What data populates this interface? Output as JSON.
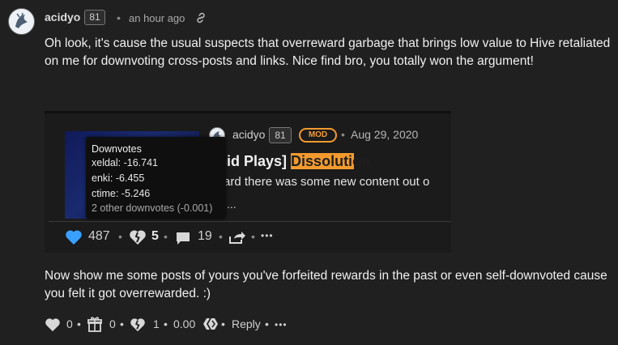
{
  "comment": {
    "username": "acidyo",
    "reputation": "81",
    "time": "an hour ago",
    "paragraph1": "Oh look, it's cause the usual suspects that overreward garbage that brings low value to Hive retaliated on me for downvoting cross-posts and links. Nice find bro, you totally won the argument!",
    "paragraph2": "Now show me some posts of yours you've forfeited rewards in the past or even self-downvoted cause you felt it got overrewarded. :)"
  },
  "embed": {
    "username": "acidyo",
    "reputation": "81",
    "mod_badge": "MOD",
    "date": "Aug 29, 2020",
    "title_prefix": "cid Plays] ",
    "title_highlight": "Dissolu",
    "title_highlight2": "tion",
    "snippet": "ard there was some new content out o",
    "ellipsis": "...",
    "stats": {
      "upvotes": "487",
      "downvotes": "5",
      "comments": "19"
    }
  },
  "tooltip": {
    "header": "Downvotes",
    "lines": [
      "xeldal: -16.741",
      "enki: -6.455",
      "ctime: -5.246"
    ],
    "other": "2 other downvotes (-0.001)"
  },
  "footer": {
    "upvotes": "0",
    "gifts": "0",
    "downvotes": "1",
    "payout": "0.00",
    "reply": "Reply",
    "more": "•••"
  },
  "colors": {
    "accent_orange": "#f39a2e",
    "upvote_blue": "#3aa0ff",
    "background": "#202020"
  }
}
